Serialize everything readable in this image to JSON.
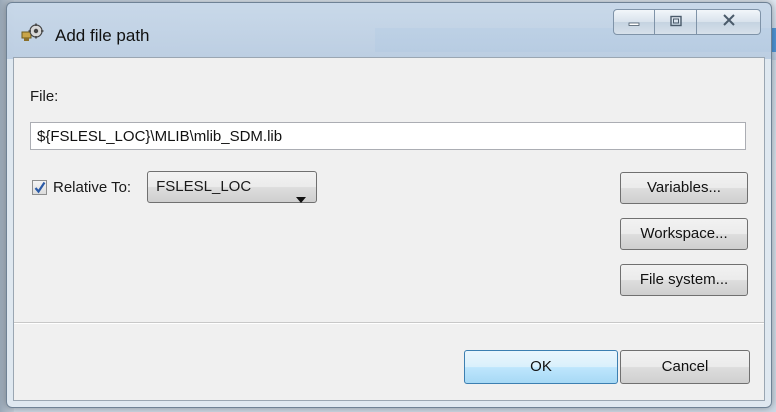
{
  "window": {
    "title": "Add file path",
    "icon": "eclipse-gear-icon"
  },
  "form": {
    "file_label": "File:",
    "file_value": "${FSLESL_LOC}\\MLIB\\mlib_SDM.lib",
    "relative_checked": true,
    "relative_label": "Relative To:",
    "relative_selected": "FSLESL_LOC"
  },
  "buttons": {
    "variables": "Variables...",
    "workspace": "Workspace...",
    "file_system": "File system...",
    "ok": "OK",
    "cancel": "Cancel"
  },
  "colors": {
    "default_button_border": "#3c7fb1",
    "checkmark": "#2a5aa7"
  }
}
